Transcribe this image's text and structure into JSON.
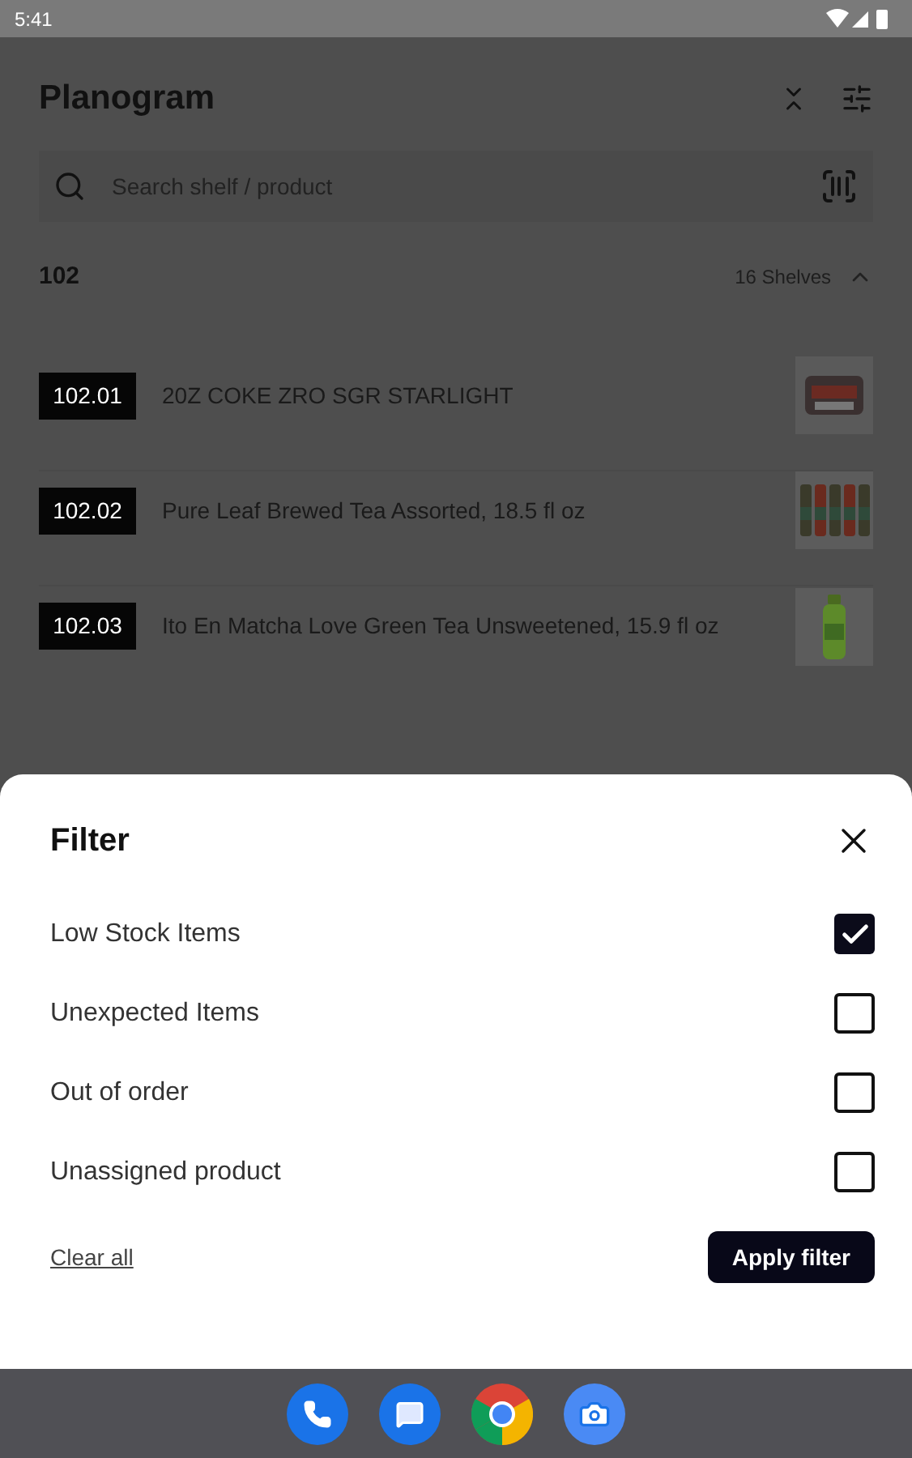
{
  "status_bar": {
    "time": "5:41"
  },
  "header": {
    "title": "Planogram"
  },
  "search": {
    "placeholder": "Search shelf / product"
  },
  "section": {
    "name": "102",
    "count": "16 Shelves",
    "expanded": true
  },
  "shelves": [
    {
      "code": "102.01",
      "name": "20Z COKE ZRO SGR STARLIGHT"
    },
    {
      "code": "102.02",
      "name": "Pure Leaf Brewed Tea Assorted, 18.5 fl oz"
    },
    {
      "code": "102.03",
      "name": "Ito En Matcha Love Green Tea Unsweetened, 15.9 fl oz"
    }
  ],
  "filter_sheet": {
    "title": "Filter",
    "options": [
      {
        "label": "Low Stock Items",
        "checked": true
      },
      {
        "label": "Unexpected Items",
        "checked": false
      },
      {
        "label": "Out of order",
        "checked": false
      },
      {
        "label": "Unassigned product",
        "checked": false
      }
    ],
    "clear_link": "Clear all",
    "apply_button": "Apply filter"
  }
}
